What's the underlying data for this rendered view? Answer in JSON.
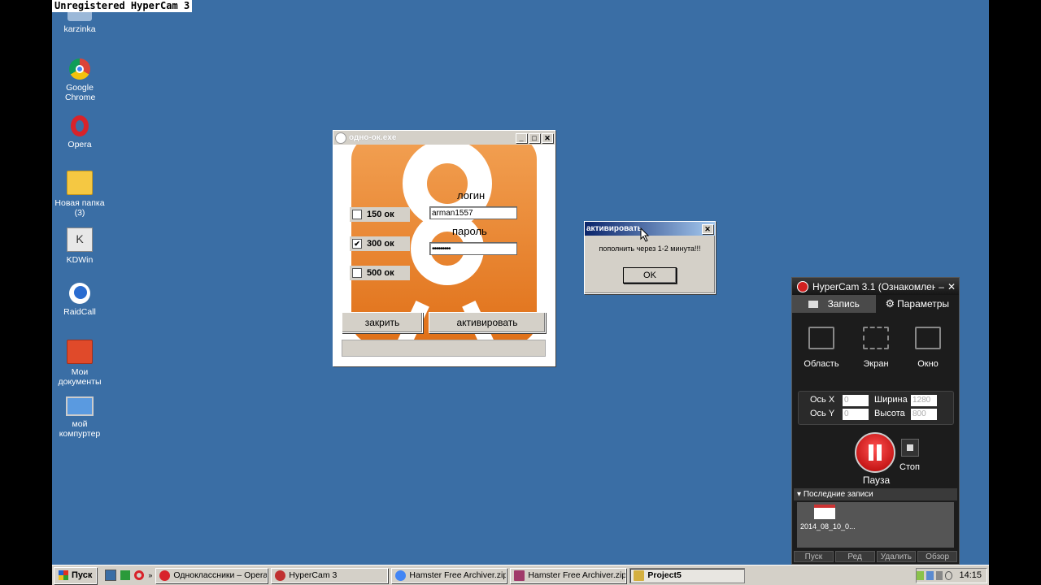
{
  "watermark": "Unregistered HyperCam 3",
  "desktop_icons": [
    {
      "label": "karzinka",
      "icon": "recycle-bin-icon"
    },
    {
      "label": "Google Chrome",
      "icon": "chrome-icon"
    },
    {
      "label": "Opera",
      "icon": "opera-icon"
    },
    {
      "label": "Новая папка (3)",
      "icon": "folder-icon"
    },
    {
      "label": "KDWin",
      "icon": "kdwin-icon"
    },
    {
      "label": "RaidCall",
      "icon": "raidcall-icon"
    },
    {
      "label": "Мои документы",
      "icon": "my-documents-icon"
    },
    {
      "label": "мой компуртер",
      "icon": "my-computer-icon"
    }
  ],
  "ok_window": {
    "title": "одно-ок.exe",
    "login_label": "логин",
    "login_value": "arman1557",
    "password_label": "пароль",
    "password_value": "•••••••••",
    "options": [
      {
        "label": "150 ок",
        "checked": false
      },
      {
        "label": "300 ок",
        "checked": true
      },
      {
        "label": "500 ок",
        "checked": false
      }
    ],
    "close_label": "закрить",
    "activate_label": "активировать",
    "progress": 0
  },
  "dialog": {
    "title": "активировать",
    "message": "пополнить через 1-2 минута!!!",
    "ok_label": "OK"
  },
  "hypercam": {
    "title": "HyperCam 3.1 (Ознакомлен",
    "tab_record": "Запись",
    "tab_params": "Параметры",
    "modes": [
      "Область",
      "Экран",
      "Окно"
    ],
    "axis_x_label": "Ось X",
    "axis_x_value": "0",
    "axis_y_label": "Ось Y",
    "axis_y_value": "0",
    "width_label": "Ширина",
    "width_value": "1280",
    "height_label": "Высота",
    "height_value": "800",
    "pause_label": "Пауза",
    "stop_label": "Стоп",
    "recent_label": "Последние записи",
    "recent_file": "2014_08_10_0...",
    "footer": [
      "Пуск",
      "Ред",
      "Удалить",
      "Обзор"
    ]
  },
  "taskbar": {
    "start_label": "Пуск",
    "buttons": [
      {
        "label": "Одноклассники – Opera",
        "color": "#d8232a"
      },
      {
        "label": "HyperCam 3",
        "color": "#c03030"
      },
      {
        "label": "Hamster Free Archiver.zip...",
        "color": "#4285f4"
      },
      {
        "label": "Hamster Free Archiver.zip...",
        "color": "#a03a6a"
      },
      {
        "label": "Project5",
        "color": "#d4b040"
      }
    ],
    "clock": "14:15"
  }
}
